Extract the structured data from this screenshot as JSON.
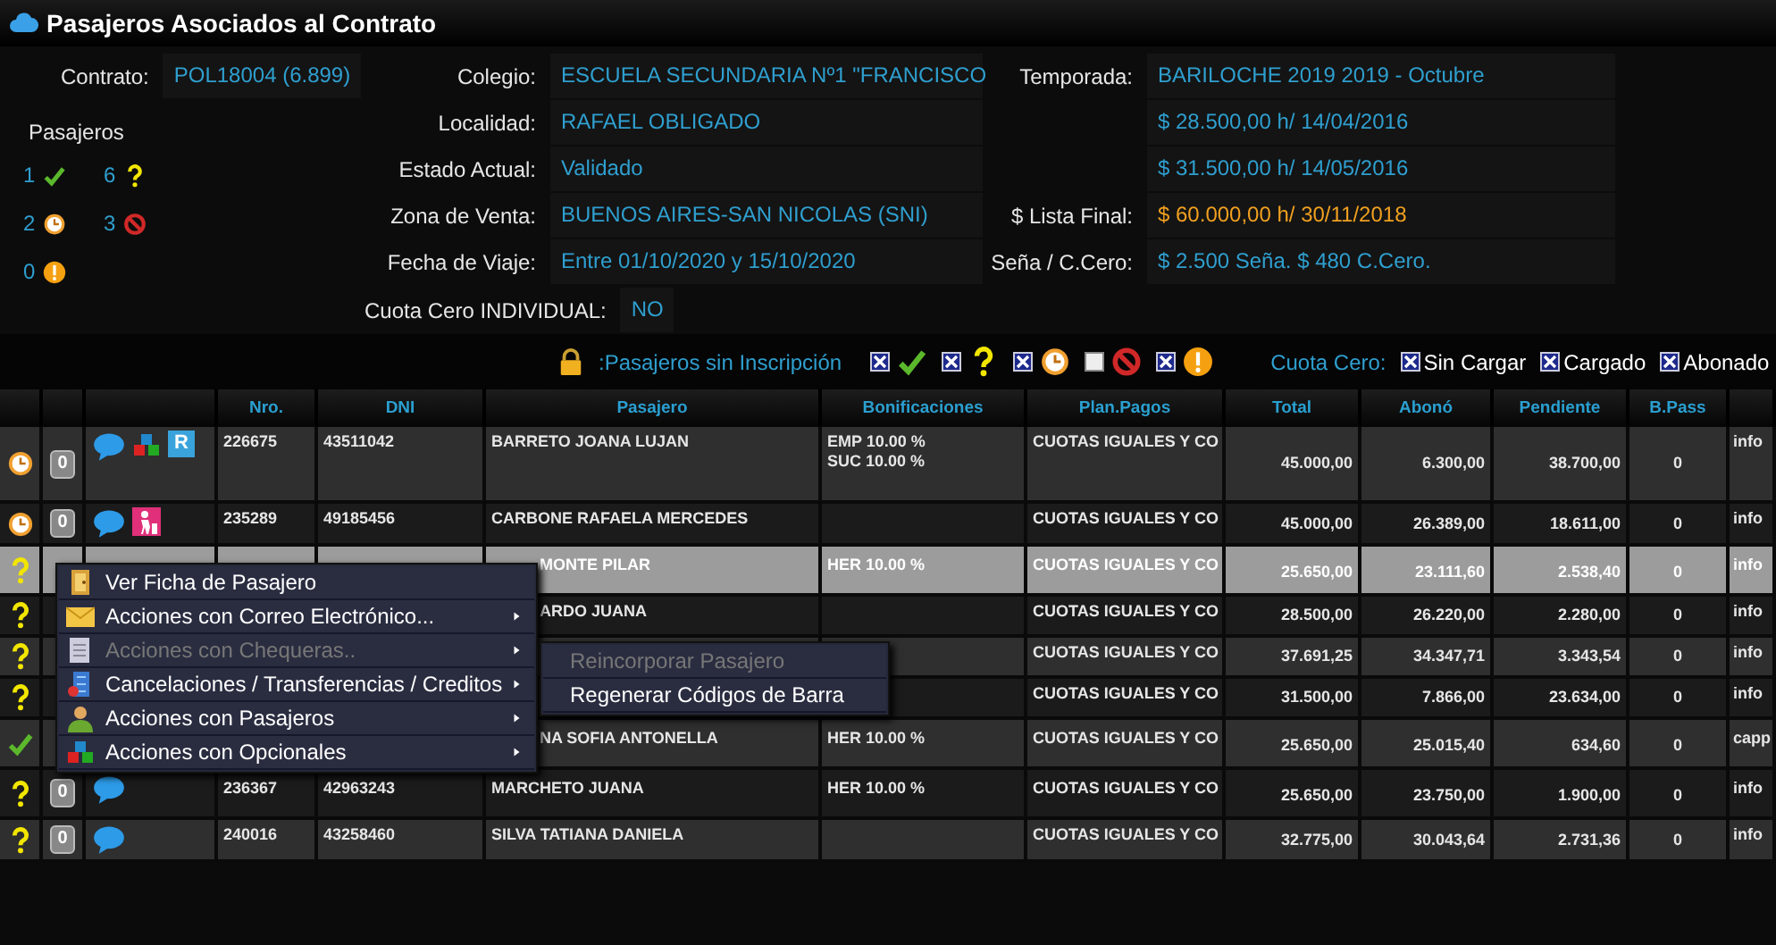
{
  "window": {
    "title": "Pasajeros Asociados al Contrato"
  },
  "contract": {
    "fields_left": [
      {
        "label": "Contrato:",
        "value": "POL18004 (6.899)"
      }
    ],
    "passenger_counts_title": "Pasajeros",
    "passenger_counts": [
      {
        "count": "1",
        "kind": "ok"
      },
      {
        "count": "6",
        "kind": "pending"
      },
      {
        "count": "2",
        "kind": "waiting"
      },
      {
        "count": "3",
        "kind": "blocked"
      },
      {
        "count": "0",
        "kind": "alert"
      }
    ],
    "fields_middle": [
      {
        "label": "Colegio:",
        "value": "ESCUELA SECUNDARIA Nº1 \"FRANCISCO"
      },
      {
        "label": "Localidad:",
        "value": "RAFAEL OBLIGADO"
      },
      {
        "label": "Estado Actual:",
        "value": "Validado"
      },
      {
        "label": "Zona de Venta:",
        "value": "BUENOS AIRES-SAN NICOLAS (SNI)"
      },
      {
        "label": "Fecha de Viaje:",
        "value": "Entre 01/10/2020 y 15/10/2020"
      }
    ],
    "fields_right": [
      {
        "label": "Temporada:",
        "value": "BARILOCHE 2019 2019 - Octubre",
        "highlight": false
      },
      {
        "value": "$ 28.500,00 h/ 14/04/2016",
        "highlight": false
      },
      {
        "value": "$ 31.500,00 h/ 14/05/2016",
        "highlight": false
      },
      {
        "label": "$ Lista Final:",
        "value": "$ 60.000,00 h/ 30/11/2018",
        "highlight": true
      },
      {
        "label": "Seña / C.Cero:",
        "value": "$ 2.500 Seña. $ 480 C.Cero.",
        "highlight": false
      }
    ],
    "cuota_cero_individual": {
      "label": "Cuota Cero INDIVIDUAL:",
      "value": "NO"
    }
  },
  "filters": {
    "label": ":Pasajeros sin Inscripción",
    "status_filters": [
      {
        "kind": "ok",
        "checked": true
      },
      {
        "kind": "pending",
        "checked": true
      },
      {
        "kind": "waiting",
        "checked": true
      },
      {
        "kind": "blocked",
        "checked": false
      },
      {
        "kind": "alert",
        "checked": true
      }
    ],
    "cuota_cero_label": "Cuota Cero:",
    "cuota_cero": [
      {
        "label": "Sin Cargar",
        "checked": true
      },
      {
        "label": "Cargado",
        "checked": true
      },
      {
        "label": "Abonado",
        "checked": true
      }
    ]
  },
  "table": {
    "columns": [
      "",
      "",
      "",
      "Nro.",
      "DNI",
      "Pasajero",
      "Bonificaciones",
      "Plan.Pagos",
      "Total",
      "Abonó",
      "Pendiente",
      "B.Pass",
      ""
    ],
    "rows": [
      {
        "kind": "waiting",
        "badge": "0",
        "icons": [
          {
            "kind": "chat"
          },
          {
            "kind": "blocks"
          },
          {
            "kind": "tag",
            "text": "R"
          }
        ],
        "nro": "226675",
        "dni": "43511042",
        "pasajero": "BARRETO JOANA LUJAN",
        "bonificaciones": [
          "EMP 10.00 %",
          "SUC 10.00 %"
        ],
        "plan": "CUOTAS IGUALES Y CO",
        "total": "45.000,00",
        "abono": "6.300,00",
        "pendiente": "38.700,00",
        "bpass": "0",
        "email": "info",
        "selected": false,
        "under_menu": false
      },
      {
        "kind": "waiting",
        "badge": "0",
        "icons": [
          {
            "kind": "chat"
          },
          {
            "kind": "person"
          }
        ],
        "nro": "235289",
        "dni": "49185456",
        "pasajero": "CARBONE RAFAELA MERCEDES",
        "bonificaciones": [],
        "plan": "CUOTAS IGUALES Y CO",
        "total": "45.000,00",
        "abono": "26.389,00",
        "pendiente": "18.611,00",
        "bpass": "0",
        "email": "info",
        "selected": false,
        "under_menu": false
      },
      {
        "kind": "pending",
        "icons": [],
        "pasajero": "MONTE PILAR",
        "bonificaciones": [
          "HER 10.00 %"
        ],
        "plan": "CUOTAS IGUALES Y CO",
        "total": "25.650,00",
        "abono": "23.111,60",
        "pendiente": "2.538,40",
        "bpass": "0",
        "email": "info",
        "selected": true,
        "under_menu": true
      },
      {
        "kind": "pending",
        "icons": [],
        "pasajero": "ARDO JUANA",
        "bonificaciones": [],
        "plan": "CUOTAS IGUALES Y CO",
        "total": "28.500,00",
        "abono": "26.220,00",
        "pendiente": "2.280,00",
        "bpass": "0",
        "email": "info",
        "selected": false,
        "under_menu": true
      },
      {
        "kind": "pending",
        "icons": [],
        "bonificaciones": [],
        "plan": "CUOTAS IGUALES Y CO",
        "total": "37.691,25",
        "abono": "34.347,71",
        "pendiente": "3.343,54",
        "bpass": "0",
        "email": "info",
        "selected": false
      },
      {
        "kind": "pending",
        "icons": [],
        "bonificaciones": [],
        "plan": "CUOTAS IGUALES Y CO",
        "total": "31.500,00",
        "abono": "7.866,00",
        "pendiente": "23.634,00",
        "bpass": "0",
        "email": "info",
        "selected": false
      },
      {
        "kind": "ok",
        "icons": [],
        "pasajero": "NA SOFIA ANTONELLA",
        "bonificaciones": [
          "HER 10.00 %"
        ],
        "plan": "CUOTAS IGUALES Y CO",
        "total": "25.650,00",
        "abono": "25.015,40",
        "pendiente": "634,60",
        "bpass": "0",
        "email": "capp",
        "selected": false,
        "under_menu": true
      },
      {
        "kind": "pending",
        "badge": "0",
        "icons": [
          {
            "kind": "chat"
          }
        ],
        "nro": "236367",
        "dni": "42963243",
        "pasajero": "MARCHETO JUANA",
        "bonificaciones": [
          "HER 10.00 %"
        ],
        "plan": "CUOTAS IGUALES Y CO",
        "total": "25.650,00",
        "abono": "23.750,00",
        "pendiente": "1.900,00",
        "bpass": "0",
        "email": "info",
        "selected": false,
        "under_menu": false
      },
      {
        "kind": "pending",
        "badge": "0",
        "icons": [
          {
            "kind": "chat"
          }
        ],
        "nro": "240016",
        "dni": "43258460",
        "pasajero": "SILVA TATIANA DANIELA",
        "bonificaciones": [],
        "plan": "CUOTAS IGUALES Y CO",
        "total": "32.775,00",
        "abono": "30.043,64",
        "pendiente": "2.731,36",
        "bpass": "0",
        "email": "info",
        "selected": false,
        "under_menu": false
      }
    ]
  },
  "context_menu": {
    "items": [
      {
        "label": "Ver Ficha de Pasajero",
        "submenu": false,
        "disabled": false
      },
      {
        "label": "Acciones con Correo Electrónico...",
        "submenu": true,
        "disabled": false
      },
      {
        "label": "Acciones con Chequeras..",
        "submenu": true,
        "disabled": true
      },
      {
        "label": "Cancelaciones / Transferencias / Creditos",
        "submenu": true,
        "disabled": false
      },
      {
        "label": "Acciones con Pasajeros",
        "submenu": true,
        "disabled": false
      },
      {
        "label": "Acciones con Opcionales",
        "submenu": true,
        "disabled": false
      }
    ],
    "submenu_items": [
      {
        "label": "Reincorporar Pasajero",
        "disabled": true
      },
      {
        "label": "Regenerar Códigos de Barra",
        "disabled": false
      }
    ]
  }
}
